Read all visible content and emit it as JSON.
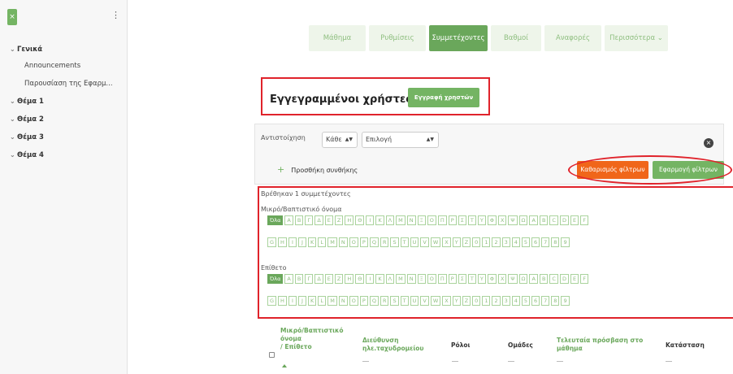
{
  "sidebar": {
    "close_glyph": "×",
    "menu_glyph": "⋮",
    "items": [
      {
        "label": "Γενικά",
        "bold": true,
        "chevron": true
      },
      {
        "label": "Announcements",
        "bold": false,
        "chevron": false
      },
      {
        "label": "Παρουσίαση της Εφαρμ...",
        "bold": false,
        "chevron": false
      },
      {
        "label": "Θέμα 1",
        "bold": true,
        "chevron": true
      },
      {
        "label": "Θέμα 2",
        "bold": true,
        "chevron": true
      },
      {
        "label": "Θέμα 3",
        "bold": true,
        "chevron": true
      },
      {
        "label": "Θέμα 4",
        "bold": true,
        "chevron": true
      }
    ]
  },
  "tabs": [
    {
      "label": "Μάθημα",
      "active": false
    },
    {
      "label": "Ρυθμίσεις",
      "active": false
    },
    {
      "label": "Συμμετέχοντες",
      "active": true
    },
    {
      "label": "Βαθμοί",
      "active": false
    },
    {
      "label": "Αναφορές",
      "active": false
    },
    {
      "label": "Περισσότερα ⌄",
      "active": false
    }
  ],
  "heading": {
    "title": "Εγγεγραμμένοι χρήστες",
    "caret": "⌄",
    "enrol_button": "Εγγραφή χρηστών"
  },
  "filter": {
    "match_label": "Αντιστοίχηση",
    "match_value": "Κάθε",
    "type_value": "Επιλογή",
    "remove_glyph": "×",
    "add_condition": "Προσθήκη συνθήκης",
    "clear_button": "Καθαρισμός φίλτρων",
    "apply_button": "Εφαρμογή φίλτρων"
  },
  "results": {
    "found_text": "Βρέθηκαν 1 συμμετέχοντες",
    "firstname_label": "Μικρό/Βαπτιστικό όνομα",
    "lastname_label": "Επίθετο",
    "all_label": "Όλα",
    "letters_row1": [
      "Α",
      "Β",
      "Γ",
      "Δ",
      "Ε",
      "Ζ",
      "Η",
      "Θ",
      "Ι",
      "Κ",
      "Λ",
      "Μ",
      "Ν",
      "Ξ",
      "Ο",
      "Π",
      "Ρ",
      "Σ",
      "Τ",
      "Υ",
      "Φ",
      "Χ",
      "Ψ",
      "Ω",
      "A",
      "B",
      "C",
      "D",
      "E",
      "F"
    ],
    "letters_row2": [
      "G",
      "H",
      "I",
      "J",
      "K",
      "L",
      "M",
      "N",
      "O",
      "P",
      "Q",
      "R",
      "S",
      "T",
      "U",
      "V",
      "W",
      "X",
      "Y",
      "Z",
      "0",
      "1",
      "2",
      "3",
      "4",
      "5",
      "6",
      "7",
      "8",
      "9"
    ]
  },
  "table": {
    "name_header_line1": "Μικρό/Βαπτιστικό",
    "name_header_line2": "όνομα",
    "name_header_line3": "/ Επίθετο",
    "email_header_line1": "Διεύθυνση",
    "email_header_line2": "ηλε.ταχυδρομείου",
    "roles_header": "Ρόλοι",
    "groups_header": "Ομάδες",
    "access_header_line1": "Τελευταία πρόσβαση στο",
    "access_header_line2": "μάθημα",
    "status_header": "Κατάσταση"
  },
  "colors": {
    "accent": "#74b463",
    "accent_dark": "#6aa75b",
    "orange": "#f0661a",
    "annotation_red": "#e0232b"
  }
}
